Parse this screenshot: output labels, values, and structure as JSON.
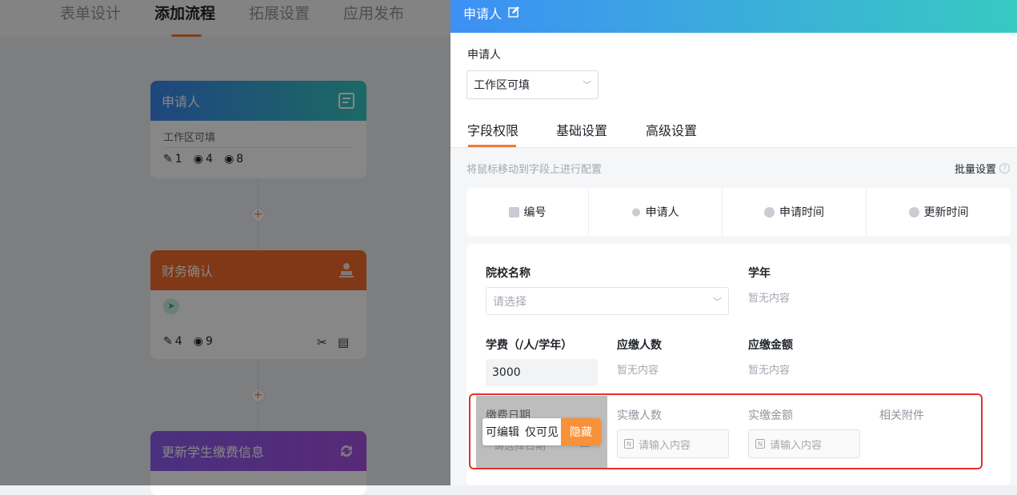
{
  "topnav": {
    "tabs": [
      "表单设计",
      "添加流程",
      "拓展设置",
      "应用发布"
    ]
  },
  "flow": {
    "node1": {
      "title": "申请人",
      "sub": "工作区可填",
      "stats": [
        "1",
        "4",
        "8"
      ],
      "color": "#3b8ff0"
    },
    "node2": {
      "title": "财务确认",
      "stats": [
        "4",
        "9"
      ],
      "color": "#f26b2a"
    },
    "node3": {
      "title": "更新学生缴费信息",
      "color": "#9b4fe6"
    },
    "plus": "+"
  },
  "panel": {
    "title": "申请人",
    "applicant_label": "申请人",
    "applicant_select": "工作区可填",
    "tabs": [
      "字段权限",
      "基础设置",
      "高级设置"
    ],
    "hint": "将鼠标移动到字段上进行配置",
    "batch": "批量设置",
    "sys_fields": [
      "编号",
      "申请人",
      "申请时间",
      "更新时间"
    ],
    "fields": {
      "school": {
        "label": "院校名称",
        "placeholder": "请选择"
      },
      "year": {
        "label": "学年",
        "empty": "暂无内容"
      },
      "fee": {
        "label": "学费（/人/学年）",
        "value": "3000"
      },
      "due_count": {
        "label": "应缴人数",
        "empty": "暂无内容"
      },
      "due_amount": {
        "label": "应缴金额",
        "empty": "暂无内容"
      },
      "pay_date": {
        "label": "缴费日期",
        "placeholder": "请选择日期"
      },
      "paid_count": {
        "label": "实缴人数",
        "placeholder": "请输入内容"
      },
      "paid_amount": {
        "label": "实缴金额",
        "placeholder": "请输入内容"
      },
      "attachments": {
        "label": "相关附件"
      }
    },
    "perm_toggle": [
      "可编辑",
      "仅可见",
      "隐藏"
    ]
  }
}
